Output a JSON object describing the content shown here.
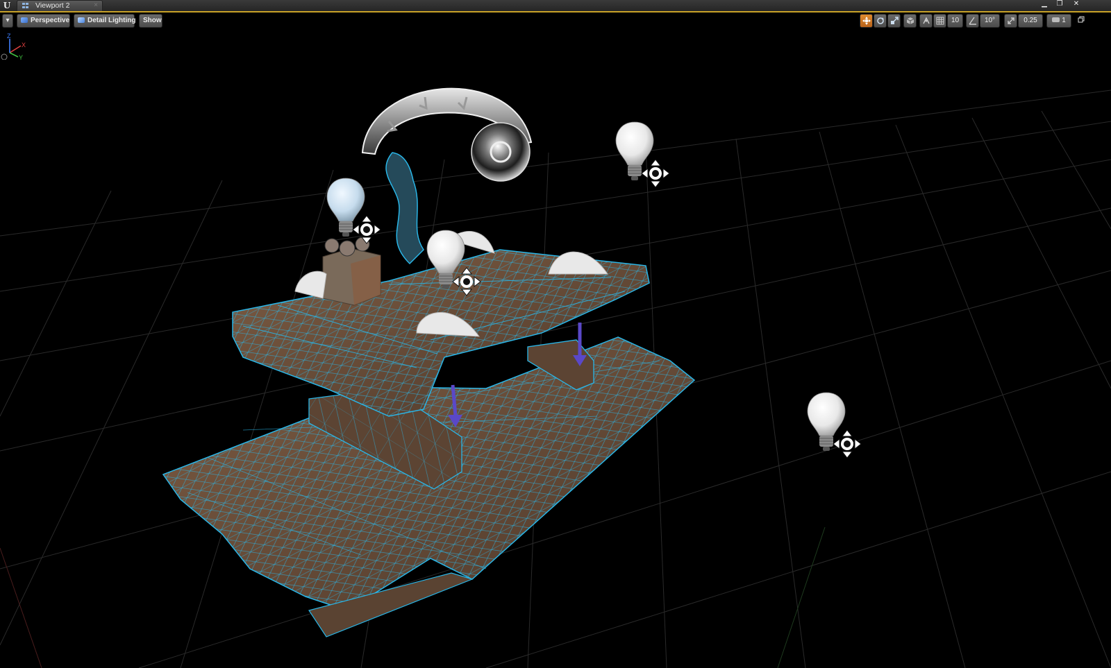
{
  "titlebar": {
    "tab_label": "Viewport 2",
    "tab_close": "×",
    "minimize": "▁",
    "maximize": "❐",
    "close": "✕"
  },
  "toolbar": {
    "menu_dropdown": "▾",
    "perspective_label": "Perspective",
    "lighting_label": "Detail Lighting",
    "show_label": "Show",
    "grid_snap_value": "10",
    "rotation_snap_value": "10°",
    "scale_snap_value": "0.25",
    "camera_speed_value": "1",
    "accent_color": "#c9a227",
    "active_tool_color": "#e08b2e"
  },
  "scene": {
    "wireframe_color": "#29b6e8",
    "wood_color": "#6b4f3a",
    "light_colors": [
      "#f4f4f4",
      "#cfe3f2"
    ],
    "icons": [
      "point-light-bulb",
      "directional-light-dome",
      "sky-reflection-sphere",
      "move-widget"
    ],
    "axis_labels": {
      "x": "X",
      "y": "Y",
      "z": "Z"
    }
  }
}
